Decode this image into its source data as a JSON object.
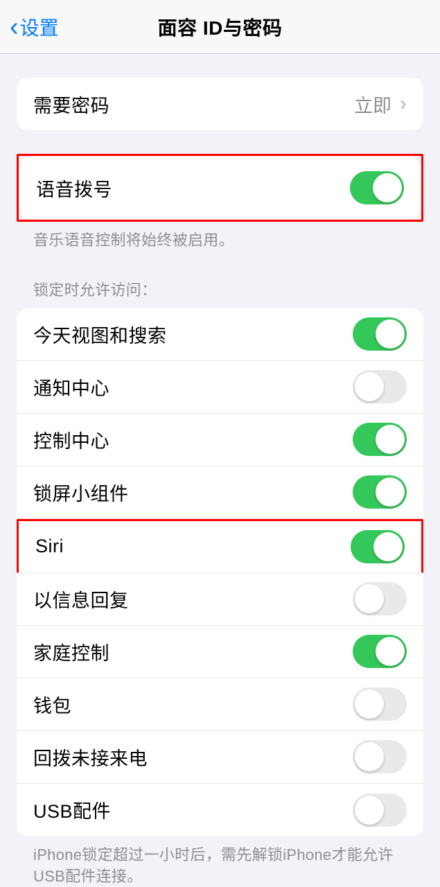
{
  "nav": {
    "back_label": "设置",
    "title": "面容 ID与密码"
  },
  "require_passcode": {
    "label": "需要密码",
    "value": "立即"
  },
  "voice_dial": {
    "label": "语音拨号",
    "on": true,
    "footer": "音乐语音控制将始终被启用。"
  },
  "allow_access": {
    "header": "锁定时允许访问：",
    "items": [
      {
        "label": "今天视图和搜索",
        "on": true
      },
      {
        "label": "通知中心",
        "on": false
      },
      {
        "label": "控制中心",
        "on": true
      },
      {
        "label": "锁屏小组件",
        "on": true
      },
      {
        "label": "Siri",
        "on": true
      },
      {
        "label": "以信息回复",
        "on": false
      },
      {
        "label": "家庭控制",
        "on": true
      },
      {
        "label": "钱包",
        "on": false
      },
      {
        "label": "回拨未接来电",
        "on": false
      },
      {
        "label": "USB配件",
        "on": false
      }
    ],
    "footer": "iPhone锁定超过一小时后，需先解锁iPhone才能允许USB配件连接。"
  }
}
